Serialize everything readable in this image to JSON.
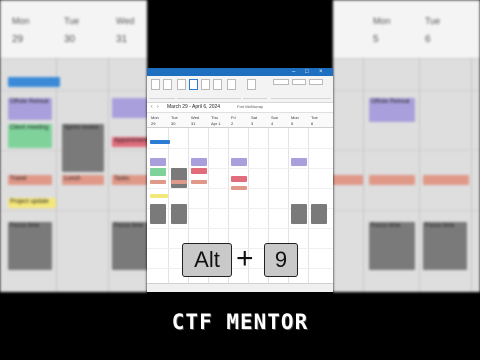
{
  "background_left": {
    "days": [
      {
        "name": "Mon",
        "num": "29"
      },
      {
        "name": "Tue",
        "num": "30"
      },
      {
        "name": "Wed",
        "num": "31"
      }
    ],
    "events": [
      {
        "label": "Offsite Retreat",
        "color": "#a99fdc"
      },
      {
        "label": "Client meeting",
        "color": "#7fd39a"
      },
      {
        "label": "Sprint review",
        "color": "#7a7a7a"
      },
      {
        "label": "Appointment",
        "color": "#e06c7c"
      },
      {
        "label": "Travel",
        "color": "#e09888"
      },
      {
        "label": "Lunch",
        "color": "#e09888"
      },
      {
        "label": "Tasks",
        "color": "#e09888"
      },
      {
        "label": "Project update",
        "color": "#f5e87a"
      },
      {
        "label": "Focus time",
        "color": "#7a7a7a"
      },
      {
        "label": "Focus time",
        "color": "#7a7a7a"
      }
    ]
  },
  "background_right": {
    "days": [
      {
        "name": "Mon",
        "num": "5"
      },
      {
        "name": "Tue",
        "num": "6"
      }
    ],
    "events": [
      {
        "label": "Offsite Retreat",
        "color": "#a99fdc"
      },
      {
        "label": "Focus time",
        "color": "#7a7a7a"
      },
      {
        "label": "Focus time",
        "color": "#7a7a7a"
      }
    ]
  },
  "outlook": {
    "nav_range": "March 29 - April 6, 2024",
    "location": "Fort McMurray",
    "days": [
      {
        "name": "Mon",
        "num": "29"
      },
      {
        "name": "Tue",
        "num": "30"
      },
      {
        "name": "Wed",
        "num": "31"
      },
      {
        "name": "Thu",
        "num": "Apr 1"
      },
      {
        "name": "Fri",
        "num": "2"
      },
      {
        "name": "Sat",
        "num": "3"
      },
      {
        "name": "Sun",
        "num": "4"
      },
      {
        "name": "Mon",
        "num": "5"
      },
      {
        "name": "Tue",
        "num": "6"
      }
    ],
    "colors": {
      "titlebar": "#1f6fc0",
      "accent": "#2b7cd3"
    }
  },
  "shortcut": {
    "key1": "Alt",
    "plus": "+",
    "key2": "9"
  },
  "caption": "CTF MENTOR"
}
